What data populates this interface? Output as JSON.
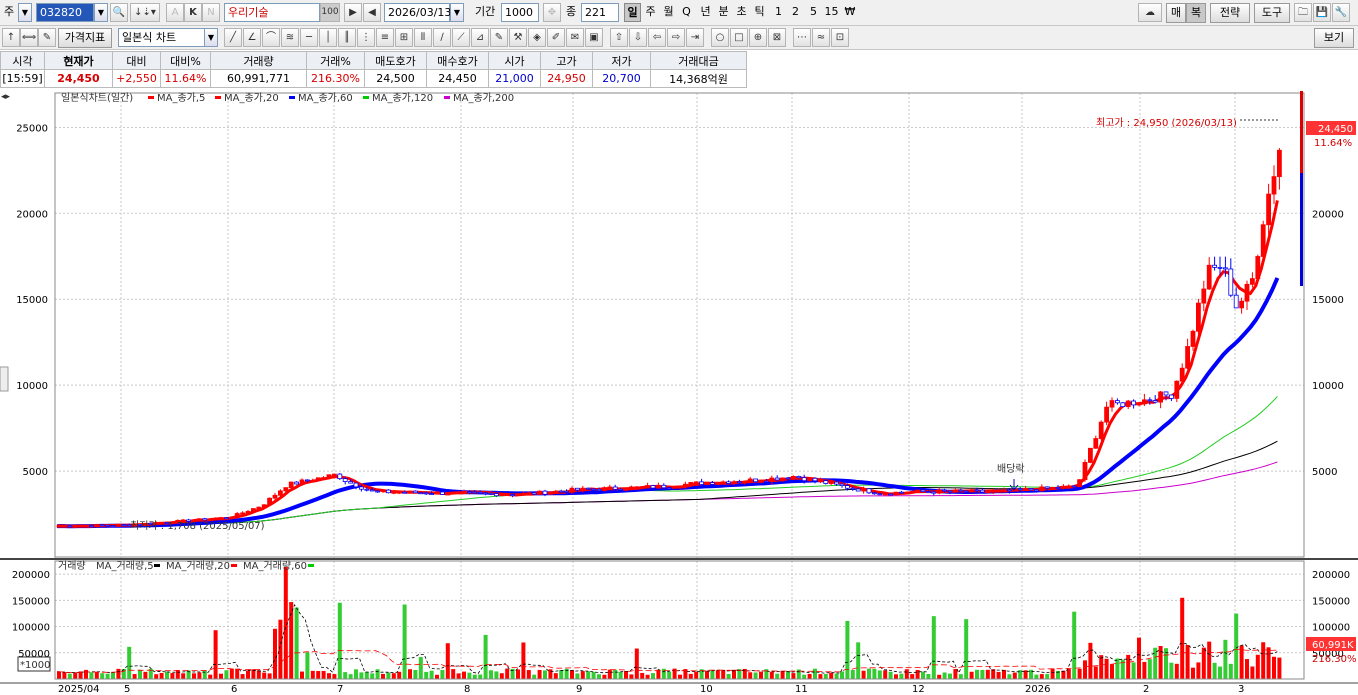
{
  "toolbar": {
    "market_label": "주",
    "code": "032820",
    "search_icon": "magnifier-icon",
    "stock_name": "우리기술",
    "date": "2026/03/13",
    "period_label": "기간",
    "period_value": "1000",
    "count_label": "종",
    "count_value": "221",
    "intervals": [
      "일",
      "주",
      "월",
      "Q",
      "년",
      "분",
      "초",
      "틱",
      "1",
      "2",
      "5",
      "15",
      "₩"
    ],
    "right_buttons": [
      "매",
      "복",
      "전략",
      "도구"
    ],
    "view_button": "보기"
  },
  "toolbar2": {
    "indicator_button": "가격지표",
    "chart_type": "일본식 차트"
  },
  "quote": {
    "headers": [
      "시각",
      "현재가",
      "대비",
      "대비%",
      "거래량",
      "거래%",
      "매도호가",
      "매수호가",
      "시가",
      "고가",
      "저가",
      "거래대금"
    ],
    "values": [
      "[15:59]",
      "24,450",
      "+2,550",
      "11.64%",
      "60,991,771",
      "216.30%",
      "24,500",
      "24,450",
      "21,000",
      "24,950",
      "20,700",
      "14,368억원"
    ],
    "colors": [
      "#000000",
      "#d60000",
      "#d60000",
      "#d60000",
      "#000000",
      "#d60000",
      "#000000",
      "#000000",
      "#0000cc",
      "#d60000",
      "#0000cc",
      "#000000"
    ]
  },
  "price_legend": {
    "title": "일본식차트(일간)",
    "items": [
      {
        "label": "MA_종가,5",
        "color": "#ff0000"
      },
      {
        "label": "MA_종가,20",
        "color": "#ff0000"
      },
      {
        "label": "MA_종가,60",
        "color": "#0000ff"
      },
      {
        "label": "MA_종가,120",
        "color": "#00cc00"
      },
      {
        "label": "MA_종가,200",
        "color": "#cc00cc"
      }
    ]
  },
  "volume_legend": {
    "title": "거래량",
    "items": [
      {
        "label": "MA_거래량,5",
        "color": "#000000"
      },
      {
        "label": "MA_거래량,20",
        "color": "#ff0000"
      },
      {
        "label": "MA_거래량,60",
        "color": "#00cc00"
      }
    ]
  },
  "annotations": {
    "high": "최고가 : 24,950 (2026/03/13)",
    "low": "최저가 : 1,708 (2025/05/07)",
    "dividend": "배당락",
    "price_tag": "24,450",
    "pct_tag": "11.64%",
    "vol_tag": "60,991K",
    "vol_pct_tag": "216.30%",
    "unit": "*1000"
  },
  "chart_data": [
    {
      "type": "candlestick",
      "title": "일본식차트(일간)",
      "ylim": [
        0,
        27000
      ],
      "yticks": [
        5000,
        10000,
        15000,
        20000,
        25000
      ],
      "x_labels": [
        "2025/04",
        "5",
        "6",
        "7",
        "8",
        "9",
        "10",
        "11",
        "12",
        "2026",
        "2",
        "3"
      ],
      "series_close_by_period": [
        {
          "x": "2025/04",
          "close": 1800
        },
        {
          "x": "5",
          "close": 1900
        },
        {
          "x": "6",
          "close": 2300
        },
        {
          "x": "6",
          "close": 4200
        },
        {
          "x": "7",
          "close": 4700
        },
        {
          "x": "7",
          "close": 3800
        },
        {
          "x": "8",
          "close": 3700
        },
        {
          "x": "9",
          "close": 3900
        },
        {
          "x": "10",
          "close": 4300
        },
        {
          "x": "11",
          "close": 4500
        },
        {
          "x": "12",
          "close": 3800
        },
        {
          "x": "2026",
          "close": 3900
        },
        {
          "x": "2026",
          "close": 4100
        },
        {
          "x": "2",
          "close": 8800
        },
        {
          "x": "2",
          "close": 9500
        },
        {
          "x": "2",
          "close": 16500
        },
        {
          "x": "3",
          "close": 14500
        },
        {
          "x": "3",
          "close": 24450
        }
      ],
      "high": 24950,
      "low": 1708
    },
    {
      "type": "bar",
      "title": "거래량",
      "unit": "*1000",
      "ylim": [
        0,
        225000
      ],
      "yticks": [
        50000,
        100000,
        150000,
        200000
      ],
      "last_value": 60991
    }
  ]
}
